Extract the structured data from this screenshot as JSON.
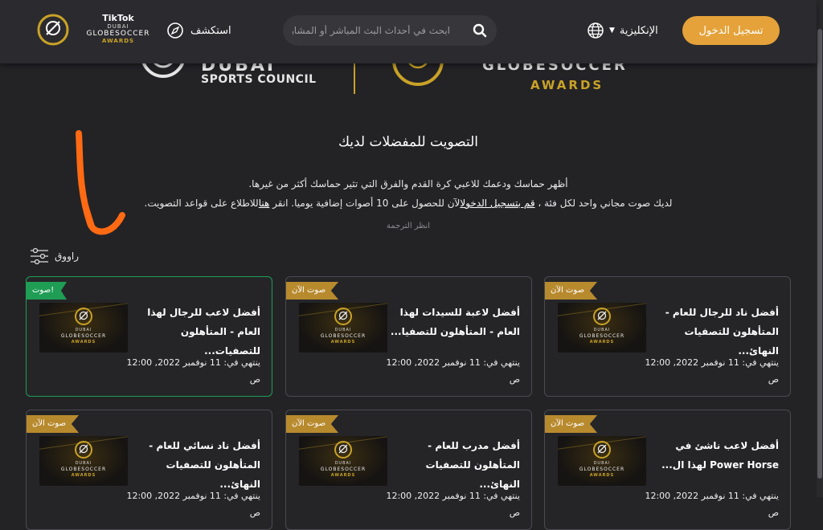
{
  "header": {
    "login_label": "تسجيل الدخول",
    "language_label": "الإنكليزية",
    "search_placeholder": "ابحث في أحداث البث المباشر أو المشاركة",
    "explore_label": "استكشف",
    "tiktok_label": "TikTok",
    "logo_dubai": "DUBAI",
    "logo_globe": "GLOBESOCCER",
    "logo_awards": "AWARDS"
  },
  "banner": {
    "sports_council": "SPORTS COUNCIL",
    "dubai": "DUBAI",
    "globe_soccer": "GLOBESOCCER",
    "awards": "AWARDS"
  },
  "intro": {
    "title": "التصويت للمفضلات لديك",
    "line1": "أظهر حماسك ودعمك للاعبي كرة القدم والفرق التي تثير حماسك أكثر من غيرها.",
    "line2_a": "لديك صوت مجاني واحد لكل فئة ، ",
    "line2_link1": "قم بتسجيل الدخول",
    "line2_b": "الآن للحصول على 10 أصوات إضافية يوميا. انقر ",
    "line2_link2": "هنا",
    "line2_c": "للاطلاع على قواعد التصويت.",
    "translate": "انظر الترجمة",
    "filters": "راووق"
  },
  "cards": [
    {
      "badge": "صوت الآن",
      "title": "أفضل ناد للرجال للعام - المتأهلون للتصفيات النهائ...",
      "ends": "ينتهي في: 11 نوفمبر 2022, 12:00 ص",
      "voted": false
    },
    {
      "badge": "صوت الآن",
      "title": "أفضل لاعبة للسيدات لهذا العام - المتأهلون للتصفيا...",
      "ends": "ينتهي في: 11 نوفمبر 2022, 12:00 ص",
      "voted": false
    },
    {
      "badge": "صوت!",
      "title": "أفضل لاعب للرجال لهذا العام - المتأهلون للتصفيات...",
      "ends": "ينتهي في: 11 نوفمبر 2022, 12:00 ص",
      "voted": true
    },
    {
      "badge": "صوت الآن",
      "title": "أفضل لاعب ناشئ في Power Horse لهذا ال...",
      "ends": "ينتهي في: 11 نوفمبر 2022, 12:00 ص",
      "voted": false
    },
    {
      "badge": "صوت الآن",
      "title": "أفضل مدرب للعام - المتأهلون للتصفيات النهائ...",
      "ends": "ينتهي في: 11 نوفمبر 2022, 12:00 ص",
      "voted": false
    },
    {
      "badge": "صوت الآن",
      "title": "أفضل ناد نسائي للعام - المتأهلون للتصفيات النهائ...",
      "ends": "ينتهي في: 11 نوفمبر 2022, 12:00 ص",
      "voted": false
    }
  ],
  "thumb_text": {
    "dubai": "DUBAI",
    "globe": "GLOBESOCCER",
    "awards": "AWARDS"
  },
  "colors": {
    "accent": "#e5a23a",
    "voted": "#1f9d55",
    "badge": "#b88a2e",
    "background": "#232326"
  }
}
